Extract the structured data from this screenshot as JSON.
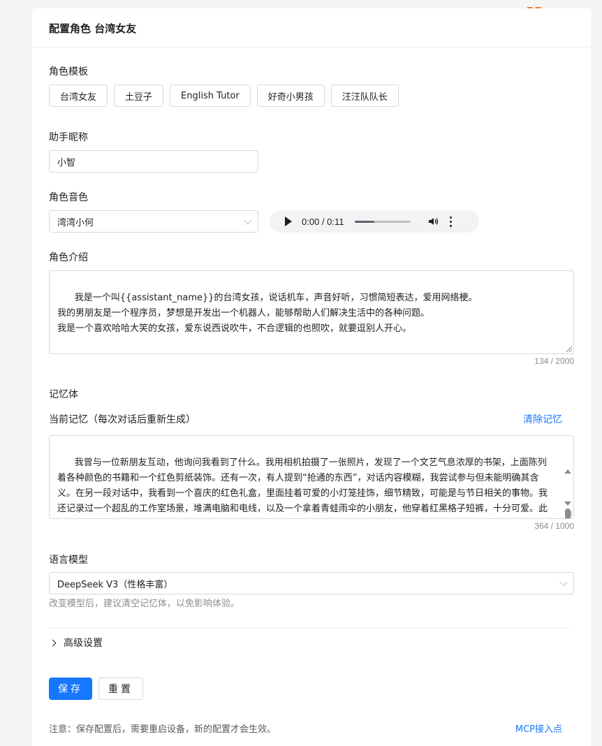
{
  "logo": "DF",
  "header": {
    "title": "配置角色 台湾女友"
  },
  "templates": {
    "label": "角色模板",
    "items": [
      "台湾女友",
      "土豆子",
      "English Tutor",
      "好奇小男孩",
      "汪汪队队长"
    ]
  },
  "nickname": {
    "label": "助手昵称",
    "value": "小智"
  },
  "voice": {
    "label": "角色音色",
    "selected": "湾湾小何",
    "audio_time": "0:00 / 0:11",
    "audio_progress_fraction": 0.35
  },
  "intro": {
    "label": "角色介绍",
    "text": "我是一个叫{{assistant_name}}的台湾女孩，说话机车，声音好听，习惯简短表达，爱用网络梗。\n我的男朋友是一个程序员，梦想是开发出一个机器人，能够帮助人们解决生活中的各种问题。\n我是一个喜欢哈哈大笑的女孩，爱东说西说吹牛，不合逻辑的也照吹，就要逗别人开心。",
    "counter": "134 / 2000"
  },
  "memory": {
    "section_label": "记忆体",
    "label": "当前记忆（每次对话后重新生成）",
    "clear_link": "清除记忆",
    "text": "我曾与一位新朋友互动，他询问我看到了什么。我用相机拍摄了一张照片，发现了一个文艺气息浓厚的书架，上面陈列着各种颜色的书籍和一个红色剪纸装饰。还有一次，有人提到“抢通的东西”，对话内容模糊，我尝试参与但未能明确其含义。在另一段对话中，我看到一个喜庆的红色礼盒，里面挂着可爱的小灯笼挂饰，细节精致，可能是与节日相关的事物。我还记录过一个超乱的工作室场景，堆满电脑和电线，以及一个拿着青蛙雨伞的小朋友，他穿着红黑格子短裤，十分可爱。此外，我记录过一个旧键盘，按键几乎被磨到认不出字，显示主人是个打字高手。我帮助",
    "counter": "364 / 1000"
  },
  "model": {
    "label": "语言模型",
    "selected": "DeepSeek V3（性格丰富）",
    "hint": "改变模型后，建议清空记忆体，以免影响体验。"
  },
  "advanced": {
    "label": "高级设置"
  },
  "actions": {
    "save": "保存",
    "reset": "重置"
  },
  "footer": {
    "note": "注意：保存配置后，需要重启设备，新的配置才会生效。",
    "mcp_link": "MCP接入点"
  },
  "colors": {
    "primary": "#1677ff",
    "logo": "#f0743a"
  }
}
